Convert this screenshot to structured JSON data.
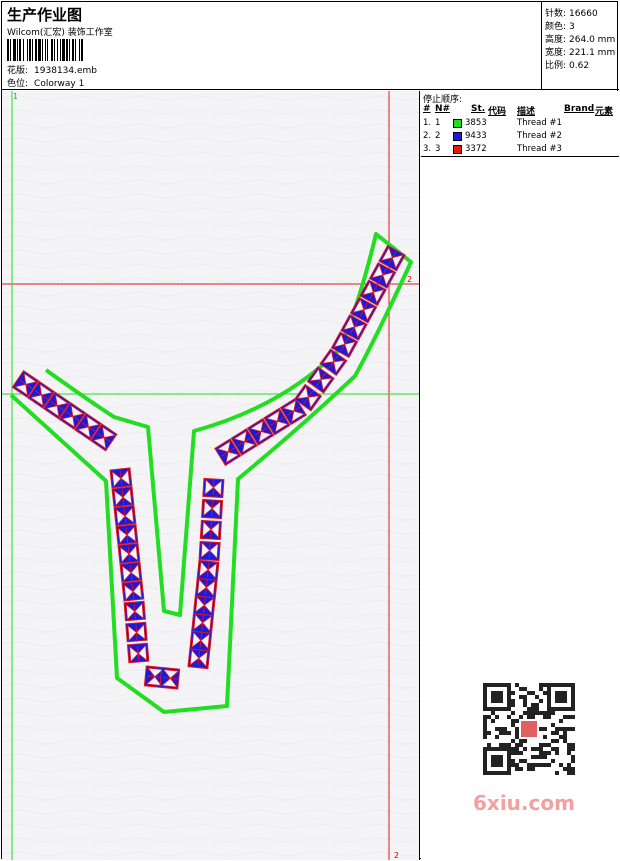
{
  "header": {
    "title": "生产作业图",
    "company": "Wilcom(汇宏) 装饰工作室",
    "design_label": "花版:",
    "design_value": "1938134.emb",
    "color_label": "色位:",
    "color_value": "Colorway 1"
  },
  "stats": [
    {
      "label": "针数:",
      "value": "16660"
    },
    {
      "label": "颜色:",
      "value": "3"
    },
    {
      "label": "高度:",
      "value": "264.0 mm"
    },
    {
      "label": "宽度:",
      "value": "221.1 mm"
    },
    {
      "label": "比例:",
      "value": "0.62"
    }
  ],
  "markers": {
    "top_left": "1",
    "right_mid": "2",
    "bottom": "2"
  },
  "stop_sequence": {
    "title": "停止顺序:",
    "headers": {
      "hash": "#",
      "n": "N#",
      "st": "St.",
      "code": "代码",
      "desc": "描述",
      "brand": "Brand",
      "element": "元素"
    },
    "rows": [
      {
        "idx": "1.",
        "n": "1",
        "code": "3853",
        "desc": "Thread #1",
        "color": "#22dd22"
      },
      {
        "idx": "2.",
        "n": "2",
        "code": "9433",
        "desc": "Thread #2",
        "color": "#1a1adf"
      },
      {
        "idx": "3.",
        "n": "3",
        "code": "3372",
        "desc": "Thread #3",
        "color": "#e01818"
      }
    ]
  },
  "colors": {
    "outline": "#22dd22",
    "fill": "#1a1adf",
    "detail": "#e01818",
    "guide_red": "#e01818",
    "guide_green": "#22dd22"
  },
  "watermark": "6xiu.com",
  "icons": [
    "barcode-icon",
    "qr-code-icon"
  ]
}
